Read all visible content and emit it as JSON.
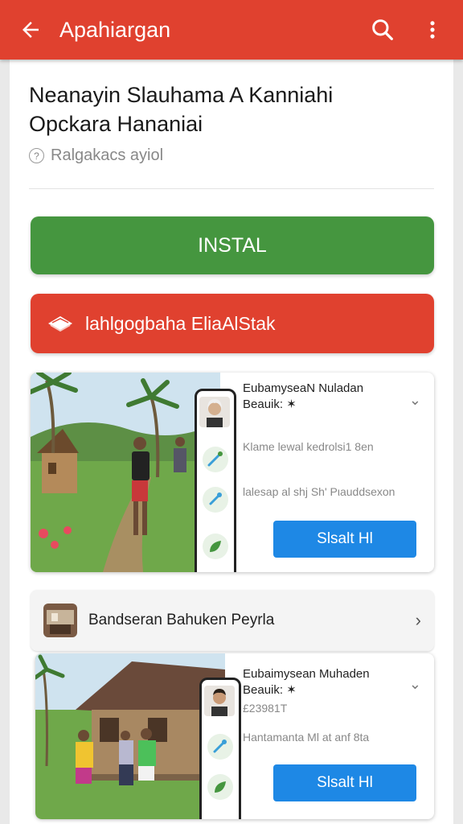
{
  "appbar": {
    "title": "Apahiargan",
    "back_icon": "arrow-left-icon",
    "search_icon": "search-icon",
    "menu_icon": "more-vert-icon",
    "color": "#e0412f"
  },
  "app": {
    "title_line1": "Neanayin Slauhama A Kanniahi",
    "title_line2": "Opckara Hananiai",
    "subtitle": "Ralgakacs ayiol"
  },
  "buttons": {
    "install_label": "INSTAL",
    "install_color": "#45963f",
    "secondary_label": "lahlgogbaha EliaAlStak",
    "secondary_icon": "book-icon"
  },
  "card1": {
    "title_line1": "EubamyseaΝ Nuladan",
    "title_line2": "Beauik: ✶",
    "line1": "Klame lewal kedrolsi1 8en",
    "line2": "lalesap al shj Sh' Pιauddsexon",
    "button_label": "Slsalt Hl"
  },
  "list_row": {
    "label": "Bandseran Bahuken Peyrla"
  },
  "card2": {
    "title_line1": "Eubaimysean Muhaden",
    "title_line2": "Beauik: ✶",
    "line1": "£23981T",
    "line2": "Hantamanta Ml at anf 8ta",
    "button_label": "Slsalt Hl"
  },
  "colors": {
    "blue_button": "#1e88e5",
    "green_button": "#45963f",
    "red": "#e0412f"
  }
}
